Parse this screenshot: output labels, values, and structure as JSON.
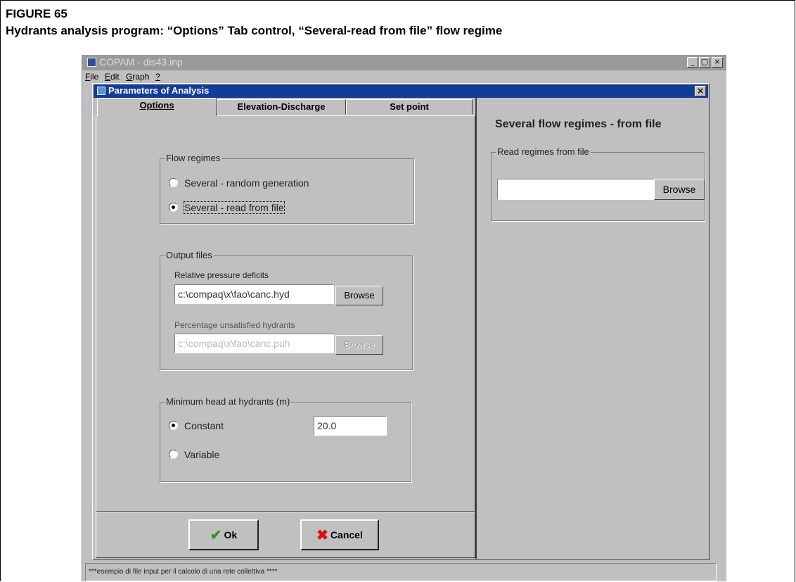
{
  "figure": {
    "number": "FIGURE 65",
    "caption": "Hydrants analysis program: “Options” Tab control, “Several-read from file” flow regime"
  },
  "app": {
    "title": "COPAM - dis43.inp",
    "window_buttons": [
      "_",
      "□",
      "×"
    ],
    "menu": [
      "File",
      "Edit",
      "Graph",
      "?"
    ]
  },
  "dialog": {
    "title": "Parameters of Analysis",
    "close_label": "×",
    "tabs": [
      {
        "label": "Options",
        "active": true
      },
      {
        "label": "Elevation-Discharge",
        "active": false
      },
      {
        "label": "Set point",
        "active": false
      }
    ],
    "flow_regimes": {
      "title": "Flow regimes",
      "options": [
        {
          "label": "Several - random generation",
          "selected": false
        },
        {
          "label": "Several - read from file",
          "selected": true
        }
      ]
    },
    "output_files": {
      "title": "Output files",
      "pressure_label": "Relative pressure deficits",
      "pressure_value": "c:\\compaq\\x\\fao\\canc.hyd",
      "pressure_browse": "Browse",
      "unsatisfied_label": "Percentage unsatisfied hydrants",
      "unsatisfied_value": "c:\\compaq\\x\\fao\\canc.puh",
      "unsatisfied_browse": "Browse"
    },
    "min_head": {
      "title": "Minimum head at hydrants (m)",
      "constant_label": "Constant",
      "constant_value": "20.0",
      "variable_label": "Variable"
    },
    "buttons": {
      "ok": "Ok",
      "cancel": "Cancel"
    },
    "right_panel": {
      "title": "Several flow regimes - from file",
      "group_title": "Read regimes from file",
      "file_value": "",
      "browse": "Browse"
    }
  },
  "status_bar": "***esempio di file input per il calcolo di una rete collettiva ****"
}
